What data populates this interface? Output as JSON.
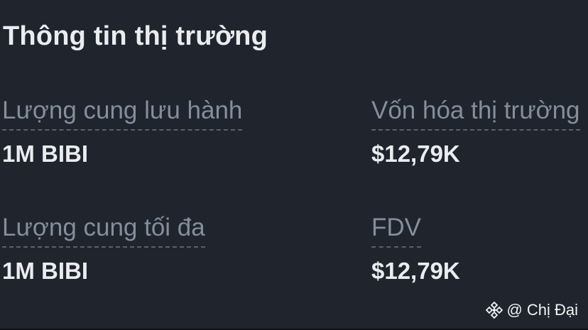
{
  "section": {
    "title": "Thông tin thị trường"
  },
  "stats": [
    {
      "label": "Lượng cung lưu hành",
      "value": "1M BIBI"
    },
    {
      "label": "Vốn hóa thị trường",
      "value": "$12,79K"
    },
    {
      "label": "Lượng cung tối đa",
      "value": "1M BIBI"
    },
    {
      "label": "FDV",
      "value": "$12,79K"
    }
  ],
  "watermark": {
    "prefix": "@",
    "author": "Chị Đại",
    "icon": "binance-logo-icon"
  },
  "colors": {
    "background": "#1f242d",
    "primary_text": "#eaecef",
    "secondary_text": "#848e9c",
    "dashed_underline": "#5a616b"
  }
}
